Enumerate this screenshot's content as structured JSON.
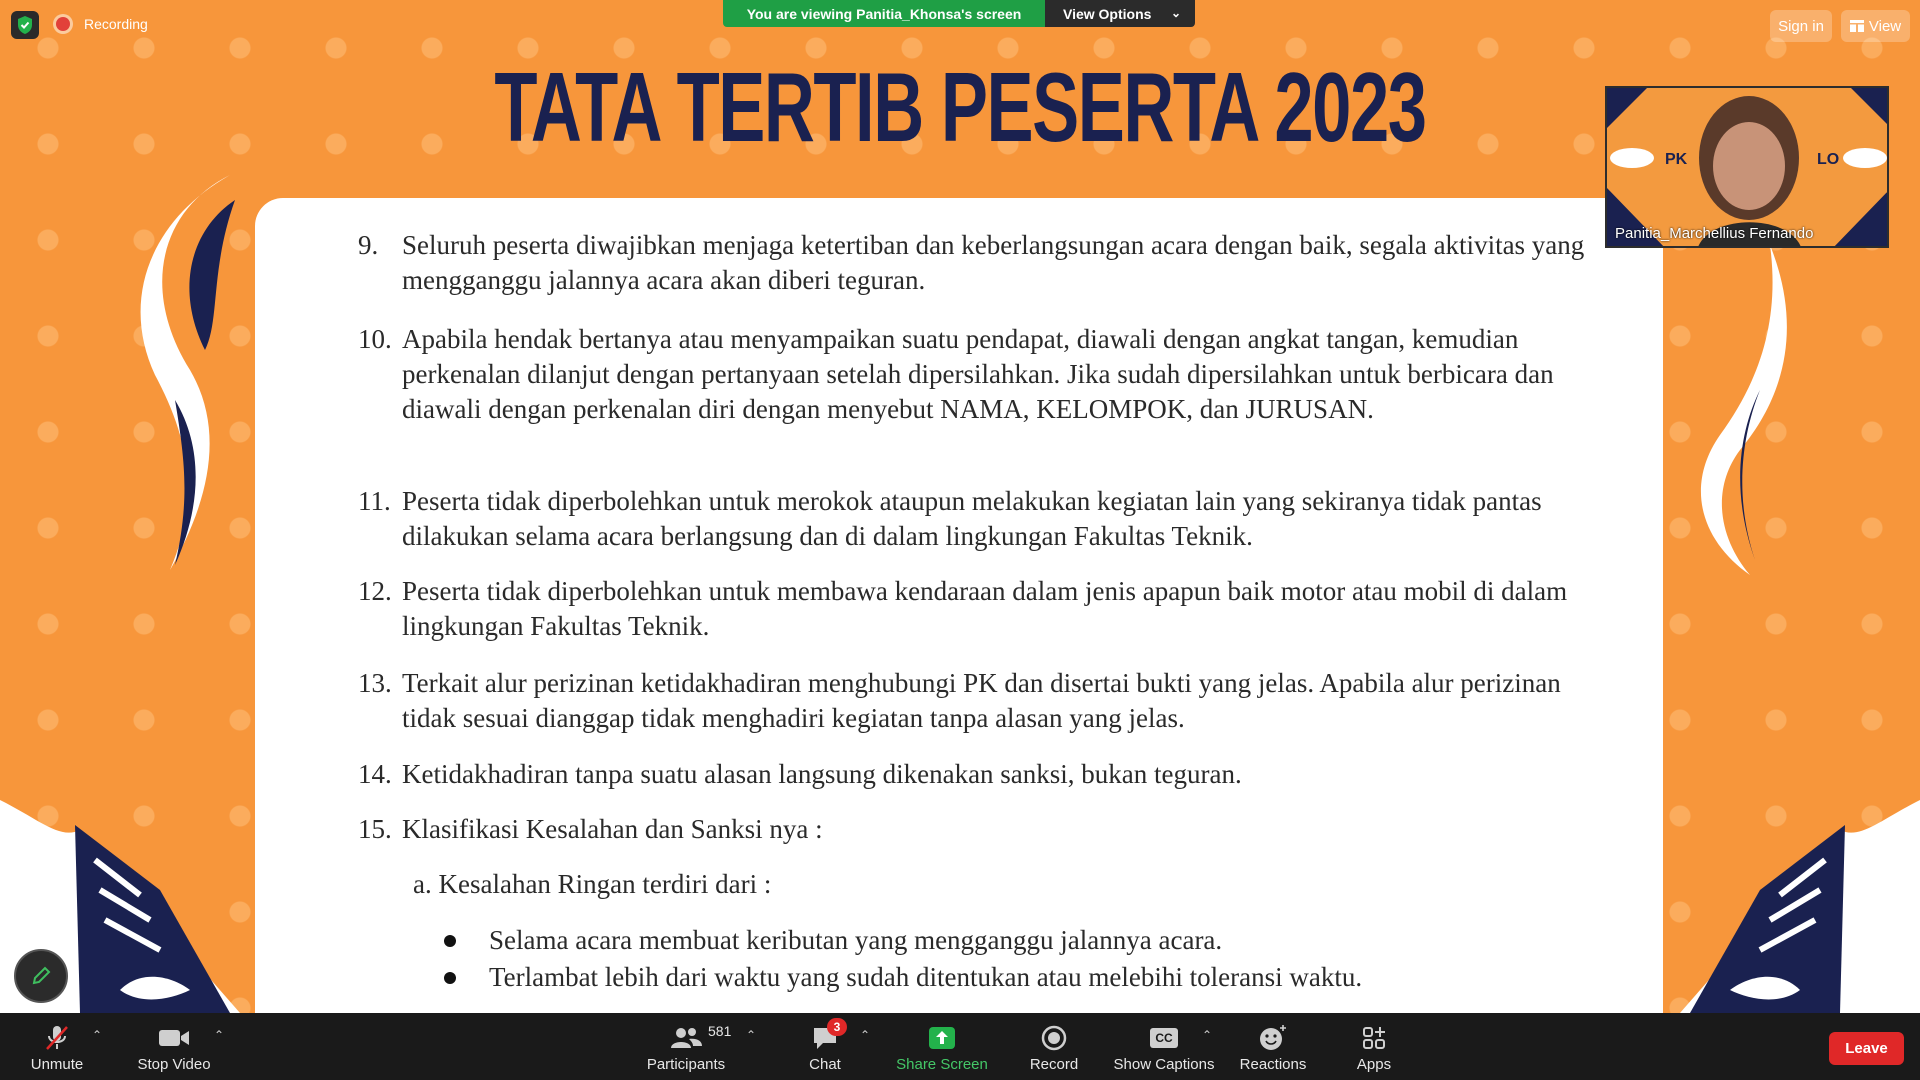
{
  "topbar": {
    "recording_label": "Recording",
    "viewing_banner": "You are viewing Panitia_Khonsa's screen",
    "view_options_label": "View Options",
    "sign_in_label": "Sign in",
    "view_label": "View"
  },
  "slide": {
    "title": "TATA TERTIB PESERTA 2023",
    "items": [
      {
        "num": "9.",
        "text": "Seluruh peserta diwajibkan menjaga ketertiban dan keberlangsungan acara dengan baik, segala aktivitas yang mengganggu jalannya acara akan diberi teguran."
      },
      {
        "num": "10.",
        "text": "Apabila hendak bertanya atau menyampaikan suatu pendapat, diawali dengan angkat tangan, kemudian perkenalan dilanjut dengan pertanyaan setelah dipersilahkan. Jika sudah dipersilahkan untuk berbicara dan diawali dengan perkenalan diri dengan menyebut NAMA, KELOMPOK, dan JURUSAN."
      },
      {
        "num": "11.",
        "text": "Peserta tidak diperbolehkan untuk merokok ataupun melakukan kegiatan lain yang sekiranya tidak pantas dilakukan selama acara berlangsung dan di dalam lingkungan Fakultas Teknik."
      },
      {
        "num": "12.",
        "text": "Peserta tidak diperbolehkan untuk membawa kendaraan dalam jenis apapun baik motor atau mobil di dalam lingkungan Fakultas Teknik."
      },
      {
        "num": "13.",
        "text": "Terkait alur perizinan ketidakhadiran menghubungi PK dan disertai bukti yang jelas. Apabila alur perizinan tidak sesuai dianggap tidak menghadiri kegiatan tanpa alasan yang jelas."
      },
      {
        "num": "14.",
        "text": "Ketidakhadiran tanpa suatu alasan langsung dikenakan sanksi, bukan teguran."
      },
      {
        "num": "15.",
        "text": "Klasifikasi Kesalahan dan Sanksi nya :"
      }
    ],
    "sub_heading": "a. Kesalahan Ringan terdiri dari :",
    "bullets": [
      "Selama acara membuat keributan yang mengganggu jalannya acara.",
      "Terlambat lebih dari waktu yang sudah ditentukan atau melebihi toleransi waktu."
    ]
  },
  "participant_video": {
    "name": "Panitia_Marchellius Fernando",
    "banner_text": "PK",
    "banner_text_right": "LO"
  },
  "toolbar": {
    "unmute": "Unmute",
    "stop_video": "Stop Video",
    "participants": "Participants",
    "participant_count": "581",
    "chat": "Chat",
    "chat_badge": "3",
    "share_screen": "Share Screen",
    "record": "Record",
    "show_captions": "Show Captions",
    "cc_icon_text": "CC",
    "reactions": "Reactions",
    "apps": "Apps",
    "leave": "Leave"
  },
  "colors": {
    "slide_bg": "#f7963b",
    "title_navy": "#1a2150",
    "share_green": "#1f9f45",
    "leave_red": "#e02828",
    "toolbar_bg": "#1a1a1a"
  }
}
